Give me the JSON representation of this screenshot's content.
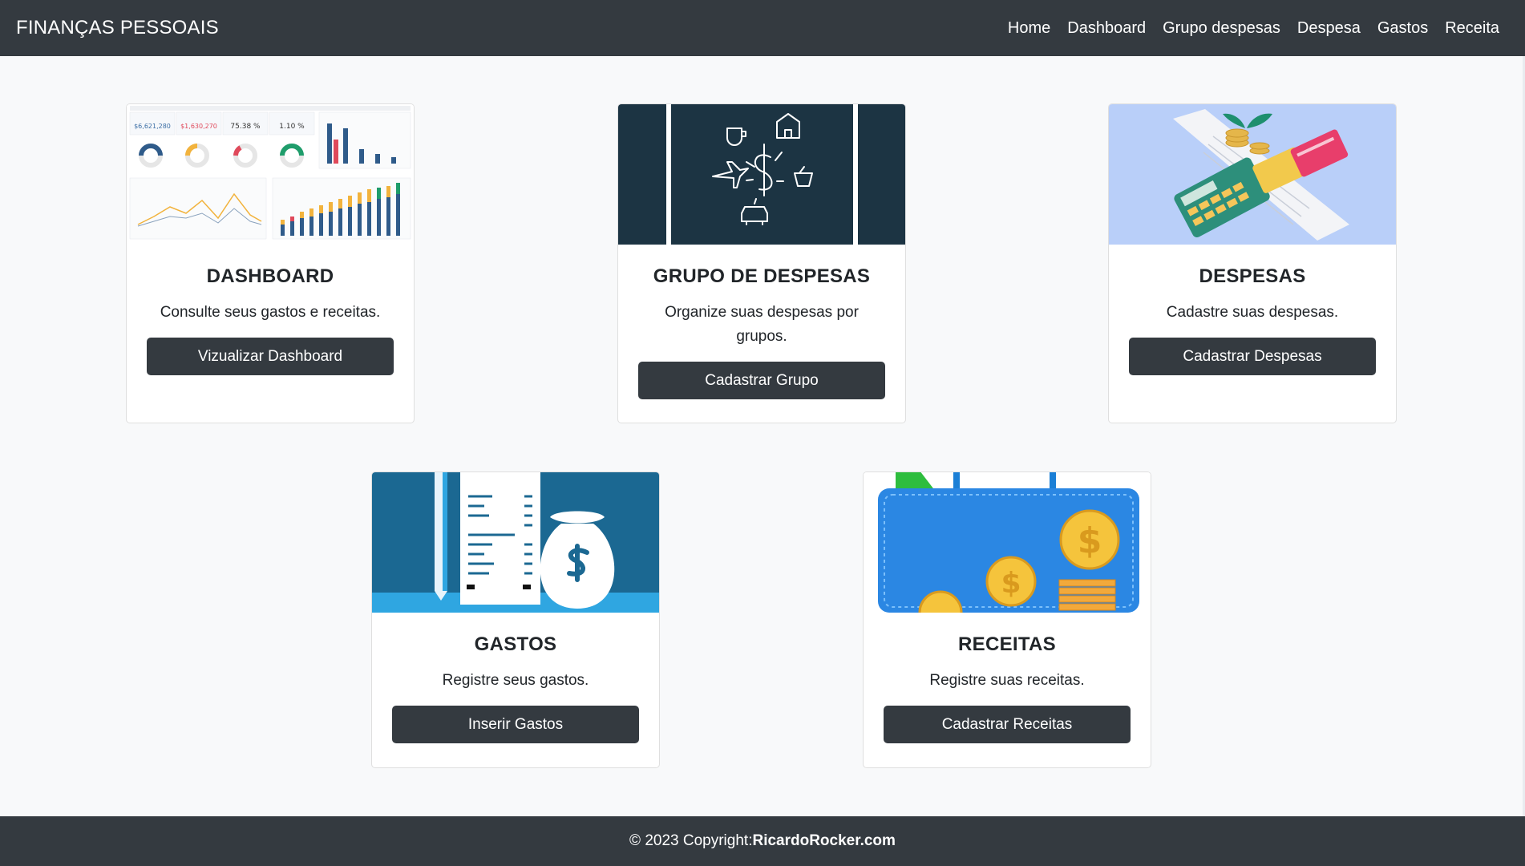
{
  "brand": "FINANÇAS PESSOAIS",
  "nav": [
    "Home",
    "Dashboard",
    "Grupo despesas",
    "Despesa",
    "Gastos",
    "Receita"
  ],
  "cards": [
    {
      "title": "DASHBOARD",
      "text": "Consulte seus gastos e receitas.",
      "button": "Vizualizar Dashboard",
      "image": "dashboard-thumbnail"
    },
    {
      "title": "GRUPO DE DESPESAS",
      "text": "Organize suas despesas por grupos.",
      "button": "Cadastrar Grupo",
      "image": "expense-icons-illustration"
    },
    {
      "title": "DESPESAS",
      "text": "Cadastre suas despesas.",
      "button": "Cadastrar Despesas",
      "image": "calculator-cards-illustration"
    },
    {
      "title": "GASTOS",
      "text": "Registre seus gastos.",
      "button": "Inserir Gastos",
      "image": "receipt-moneybag-illustration"
    },
    {
      "title": "RECEITAS",
      "text": "Registre suas receitas.",
      "button": "Cadastrar Receitas",
      "image": "briefcase-coins-illustration"
    }
  ],
  "dashboard_thumb": {
    "kpis": [
      "$6,621,280",
      "$1,630,270",
      "75.38 %",
      "1.10 %"
    ]
  },
  "footer": {
    "prefix": "© 2023 Copyright: ",
    "link": "RicardoRocker.com"
  },
  "colors": {
    "nav": "#343a40",
    "background": "#f8f9fa",
    "button": "#343a40"
  }
}
